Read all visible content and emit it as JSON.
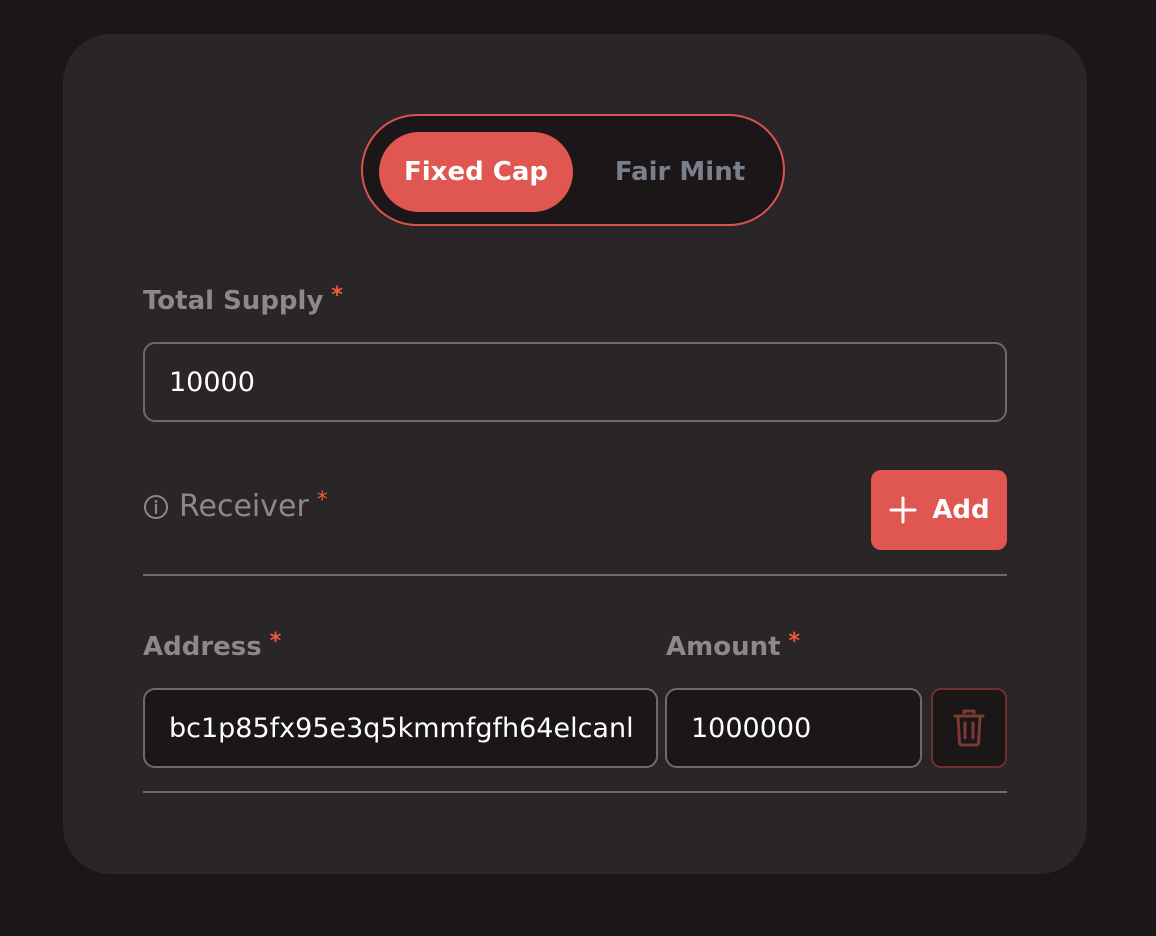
{
  "mode_toggle": {
    "options": [
      "Fixed Cap",
      "Fair Mint"
    ],
    "selected": "Fixed Cap"
  },
  "total_supply": {
    "label": "Total Supply",
    "required_mark": "*",
    "value": "10000"
  },
  "receiver": {
    "label": "Receiver",
    "required_mark": "*",
    "add_label": "Add"
  },
  "receiver_row": {
    "address_label": "Address",
    "amount_label": "Amount",
    "required_mark": "*",
    "address_value": "bc1p85fx95e3q5kmmfgfh64elcanl",
    "amount_value": "1000000"
  },
  "colors": {
    "accent": "#e05650",
    "background": "#1b1617",
    "card": "#2a2526"
  },
  "icons": {
    "info": "info-circle-icon",
    "add": "plus-icon",
    "delete": "trash-icon"
  }
}
